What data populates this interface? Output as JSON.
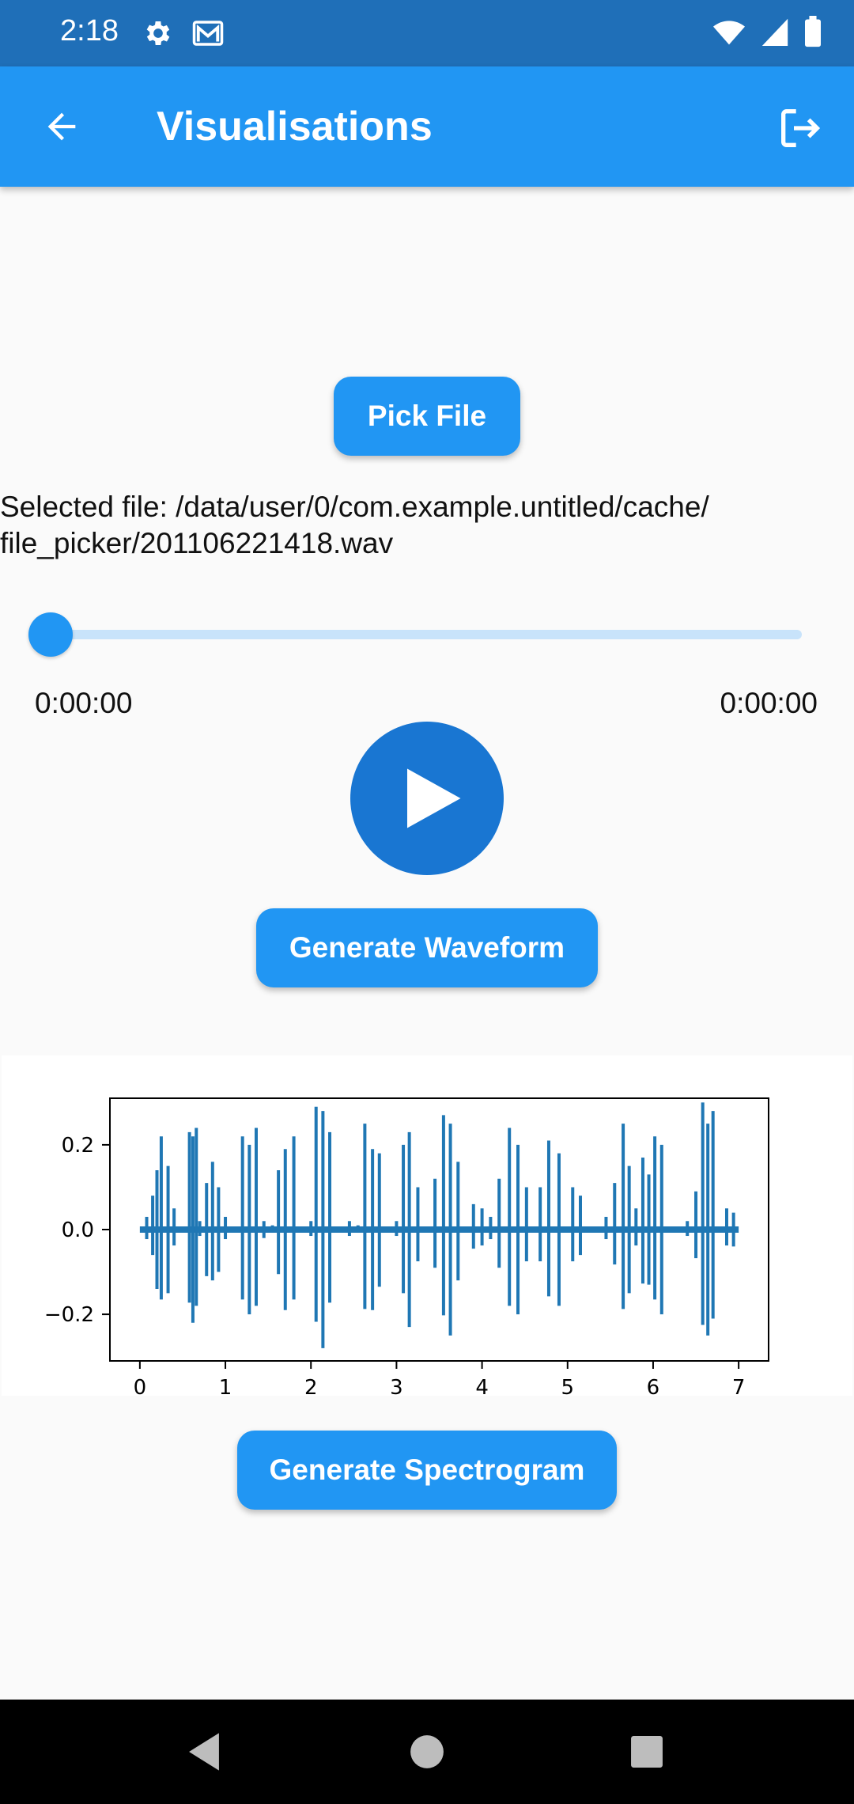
{
  "status_bar": {
    "time": "2:18",
    "icons_left": [
      "gear-icon",
      "gmail-icon"
    ],
    "icons_right": [
      "wifi-icon",
      "signal-icon",
      "battery-icon"
    ]
  },
  "app_bar": {
    "title": "Visualisations",
    "back_icon": "arrow-back-icon",
    "logout_icon": "logout-icon"
  },
  "pick_file": {
    "label": "Pick File"
  },
  "selected_file": {
    "text": "Selected file: /data/user/0/com.example.untitled/cache/ file_picker/201106221418.wav"
  },
  "player": {
    "position_fraction": 0,
    "current_time": "0:00:00",
    "total_time": "0:00:00",
    "play_icon": "play-icon"
  },
  "generate_waveform": {
    "label": "Generate Waveform"
  },
  "chart_data": {
    "type": "line",
    "title": "",
    "xlabel": "",
    "ylabel": "",
    "xlim": [
      -0.35,
      7.35
    ],
    "ylim": [
      -0.31,
      0.31
    ],
    "x_ticks": [
      0,
      1,
      2,
      3,
      4,
      5,
      6,
      7
    ],
    "x_tick_labels": [
      "0",
      "1",
      "2",
      "3",
      "4",
      "5",
      "6",
      "7"
    ],
    "y_ticks": [
      0.2,
      0.0,
      -0.2
    ],
    "y_tick_labels": [
      "0.2",
      "0.0",
      "−0.2"
    ],
    "grid": false,
    "line_color": "#1f77b4",
    "series": [
      {
        "x": [
          0.0,
          0.08,
          0.15,
          0.2,
          0.25,
          0.33,
          0.4,
          0.5,
          0.58,
          0.62,
          0.66,
          0.7,
          0.78,
          0.85,
          0.92,
          1.0,
          1.1,
          1.2,
          1.28,
          1.36,
          1.45,
          1.55,
          1.62,
          1.7,
          1.8,
          1.9,
          2.0,
          2.06,
          2.14,
          2.22,
          2.32,
          2.45,
          2.55,
          2.63,
          2.72,
          2.8,
          2.9,
          3.0,
          3.08,
          3.15,
          3.25,
          3.35,
          3.45,
          3.55,
          3.63,
          3.72,
          3.8,
          3.9,
          4.0,
          4.1,
          4.2,
          4.32,
          4.42,
          4.52,
          4.6,
          4.68,
          4.78,
          4.9,
          5.0,
          5.06,
          5.15,
          5.25,
          5.35,
          5.45,
          5.55,
          5.65,
          5.72,
          5.8,
          5.88,
          5.95,
          6.02,
          6.1,
          6.2,
          6.3,
          6.4,
          6.5,
          6.58,
          6.64,
          6.7,
          6.78,
          6.86,
          6.94,
          7.0
        ],
        "y": [
          0.0,
          0.03,
          0.08,
          -0.14,
          0.22,
          -0.15,
          0.05,
          0.0,
          0.23,
          -0.22,
          0.24,
          0.02,
          -0.11,
          0.16,
          -0.1,
          0.03,
          0.0,
          0.22,
          -0.2,
          0.24,
          -0.02,
          0.01,
          0.14,
          -0.19,
          0.22,
          0.0,
          0.02,
          0.29,
          -0.28,
          0.23,
          0.0,
          0.02,
          0.01,
          0.25,
          -0.19,
          0.18,
          0.0,
          0.02,
          0.2,
          -0.23,
          0.1,
          0.0,
          0.12,
          0.27,
          -0.25,
          0.16,
          0.0,
          0.06,
          0.05,
          0.03,
          0.12,
          0.24,
          -0.2,
          0.1,
          0.0,
          0.1,
          0.21,
          -0.18,
          0.0,
          0.1,
          0.08,
          0.0,
          0.0,
          0.03,
          0.11,
          0.25,
          -0.15,
          0.05,
          0.17,
          -0.13,
          0.22,
          -0.2,
          0.0,
          0.0,
          0.02,
          0.09,
          0.3,
          -0.25,
          0.28,
          0.0,
          0.05,
          -0.04,
          0.0
        ]
      }
    ]
  },
  "generate_spectrogram": {
    "label": "Generate Spectrogram"
  },
  "nav_bar": {
    "icons": [
      "nav-back-icon",
      "nav-home-icon",
      "nav-recents-icon"
    ]
  }
}
